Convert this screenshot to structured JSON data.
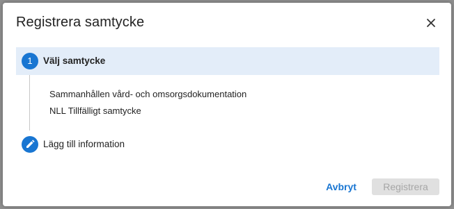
{
  "dialog": {
    "title": "Registrera samtycke",
    "close_icon": "close-icon"
  },
  "stepper": {
    "steps": [
      {
        "number": "1",
        "label": "Välj samtycke",
        "state": "active"
      },
      {
        "icon": "pencil-icon",
        "label": "Lägg till information",
        "state": "pending"
      }
    ],
    "options": [
      "Sammanhållen vård- och omsorgsdokumentation",
      "NLL Tillfälligt samtycke"
    ]
  },
  "actions": {
    "cancel_label": "Avbryt",
    "register_label": "Registrera",
    "register_disabled": true
  },
  "colors": {
    "accent": "#1976d2",
    "active_step_bg": "#e3edf9",
    "disabled_bg": "#e0e0e0",
    "disabled_text": "#a6a6a6",
    "backdrop": "#8f8f8f"
  }
}
